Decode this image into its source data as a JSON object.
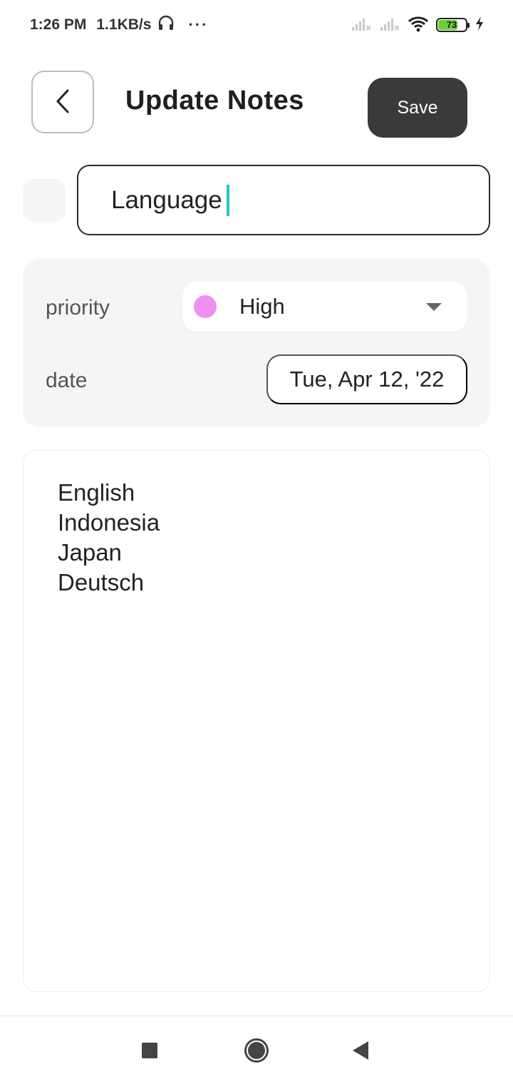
{
  "status_bar": {
    "time": "1:26 PM",
    "speed": "1.1KB/s",
    "more": "···",
    "battery_level": "73",
    "icons": [
      "headphones-icon",
      "signal-no-service-icon",
      "signal-no-service-icon",
      "wifi-icon",
      "battery-icon",
      "charging-bolt-icon"
    ]
  },
  "header": {
    "title": "Update Notes",
    "save_label": "Save",
    "back_icon": "chevron-left-icon"
  },
  "note": {
    "title": "Language",
    "lines": [
      "English",
      "Indonesia",
      "Japan",
      "Deutsch"
    ]
  },
  "settings": {
    "priority_label": "priority",
    "priority_value": "High",
    "priority_color": "#ee90f2",
    "date_label": "date",
    "date_value": "Tue, Apr 12, '22"
  },
  "colors": {
    "accent_caret": "#26c6c6",
    "save_bg": "#3a3a3a",
    "card_bg": "#f4f5f7"
  },
  "nav": {
    "icons": [
      "recent-apps-icon",
      "home-icon",
      "back-icon"
    ]
  }
}
